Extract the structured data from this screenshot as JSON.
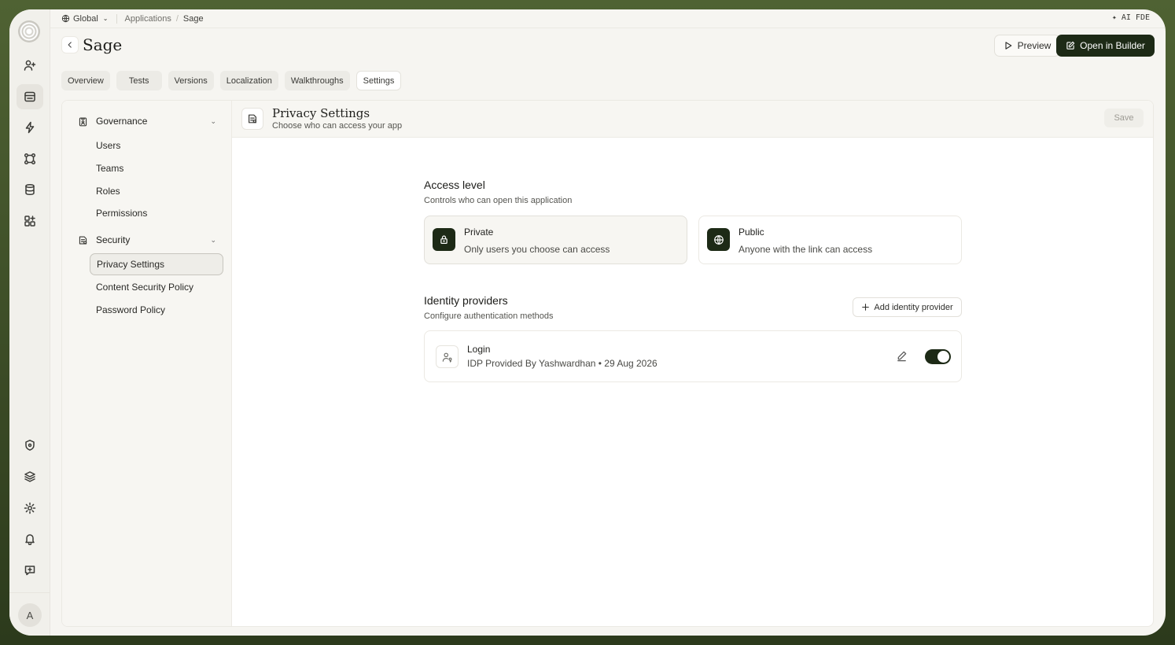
{
  "topbar": {
    "workspace": "Global",
    "breadcrumbs": [
      "Applications",
      "Sage"
    ],
    "ai_label": "AI FDE"
  },
  "header": {
    "title": "Sage",
    "preview_label": "Preview",
    "builder_label": "Open in Builder"
  },
  "tabs": [
    {
      "label": "Overview"
    },
    {
      "label": "Tests"
    },
    {
      "label": "Versions"
    },
    {
      "label": "Localization"
    },
    {
      "label": "Walkthroughs"
    },
    {
      "label": "Settings",
      "active": true
    }
  ],
  "sidebar": {
    "groups": [
      {
        "label": "Governance",
        "items": [
          "Users",
          "Teams",
          "Roles",
          "Permissions"
        ]
      },
      {
        "label": "Security",
        "items": [
          "Privacy Settings",
          "Content Security Policy",
          "Password Policy"
        ]
      }
    ],
    "selected": "Privacy Settings"
  },
  "page": {
    "title": "Privacy Settings",
    "subtitle": "Choose who can access your app",
    "save_label": "Save"
  },
  "access": {
    "title": "Access level",
    "subtitle": "Controls who can open this application",
    "options": [
      {
        "title": "Private",
        "desc": "Only users you choose can access",
        "icon": "lock-icon",
        "selected": true
      },
      {
        "title": "Public",
        "desc": "Anyone with the link can access",
        "icon": "globe-icon",
        "selected": false
      }
    ]
  },
  "identity": {
    "title": "Identity providers",
    "subtitle": "Configure authentication methods",
    "add_label": "Add identity provider",
    "providers": [
      {
        "name": "Login",
        "meta": "IDP Provided By Yashwardhan • 29 Aug 2026",
        "enabled": true
      }
    ]
  },
  "user": {
    "avatar_initial": "A"
  },
  "colors": {
    "accent": "#1d2a16",
    "frame_bg": "#f6f5f1",
    "border": "#ebe9e3"
  }
}
